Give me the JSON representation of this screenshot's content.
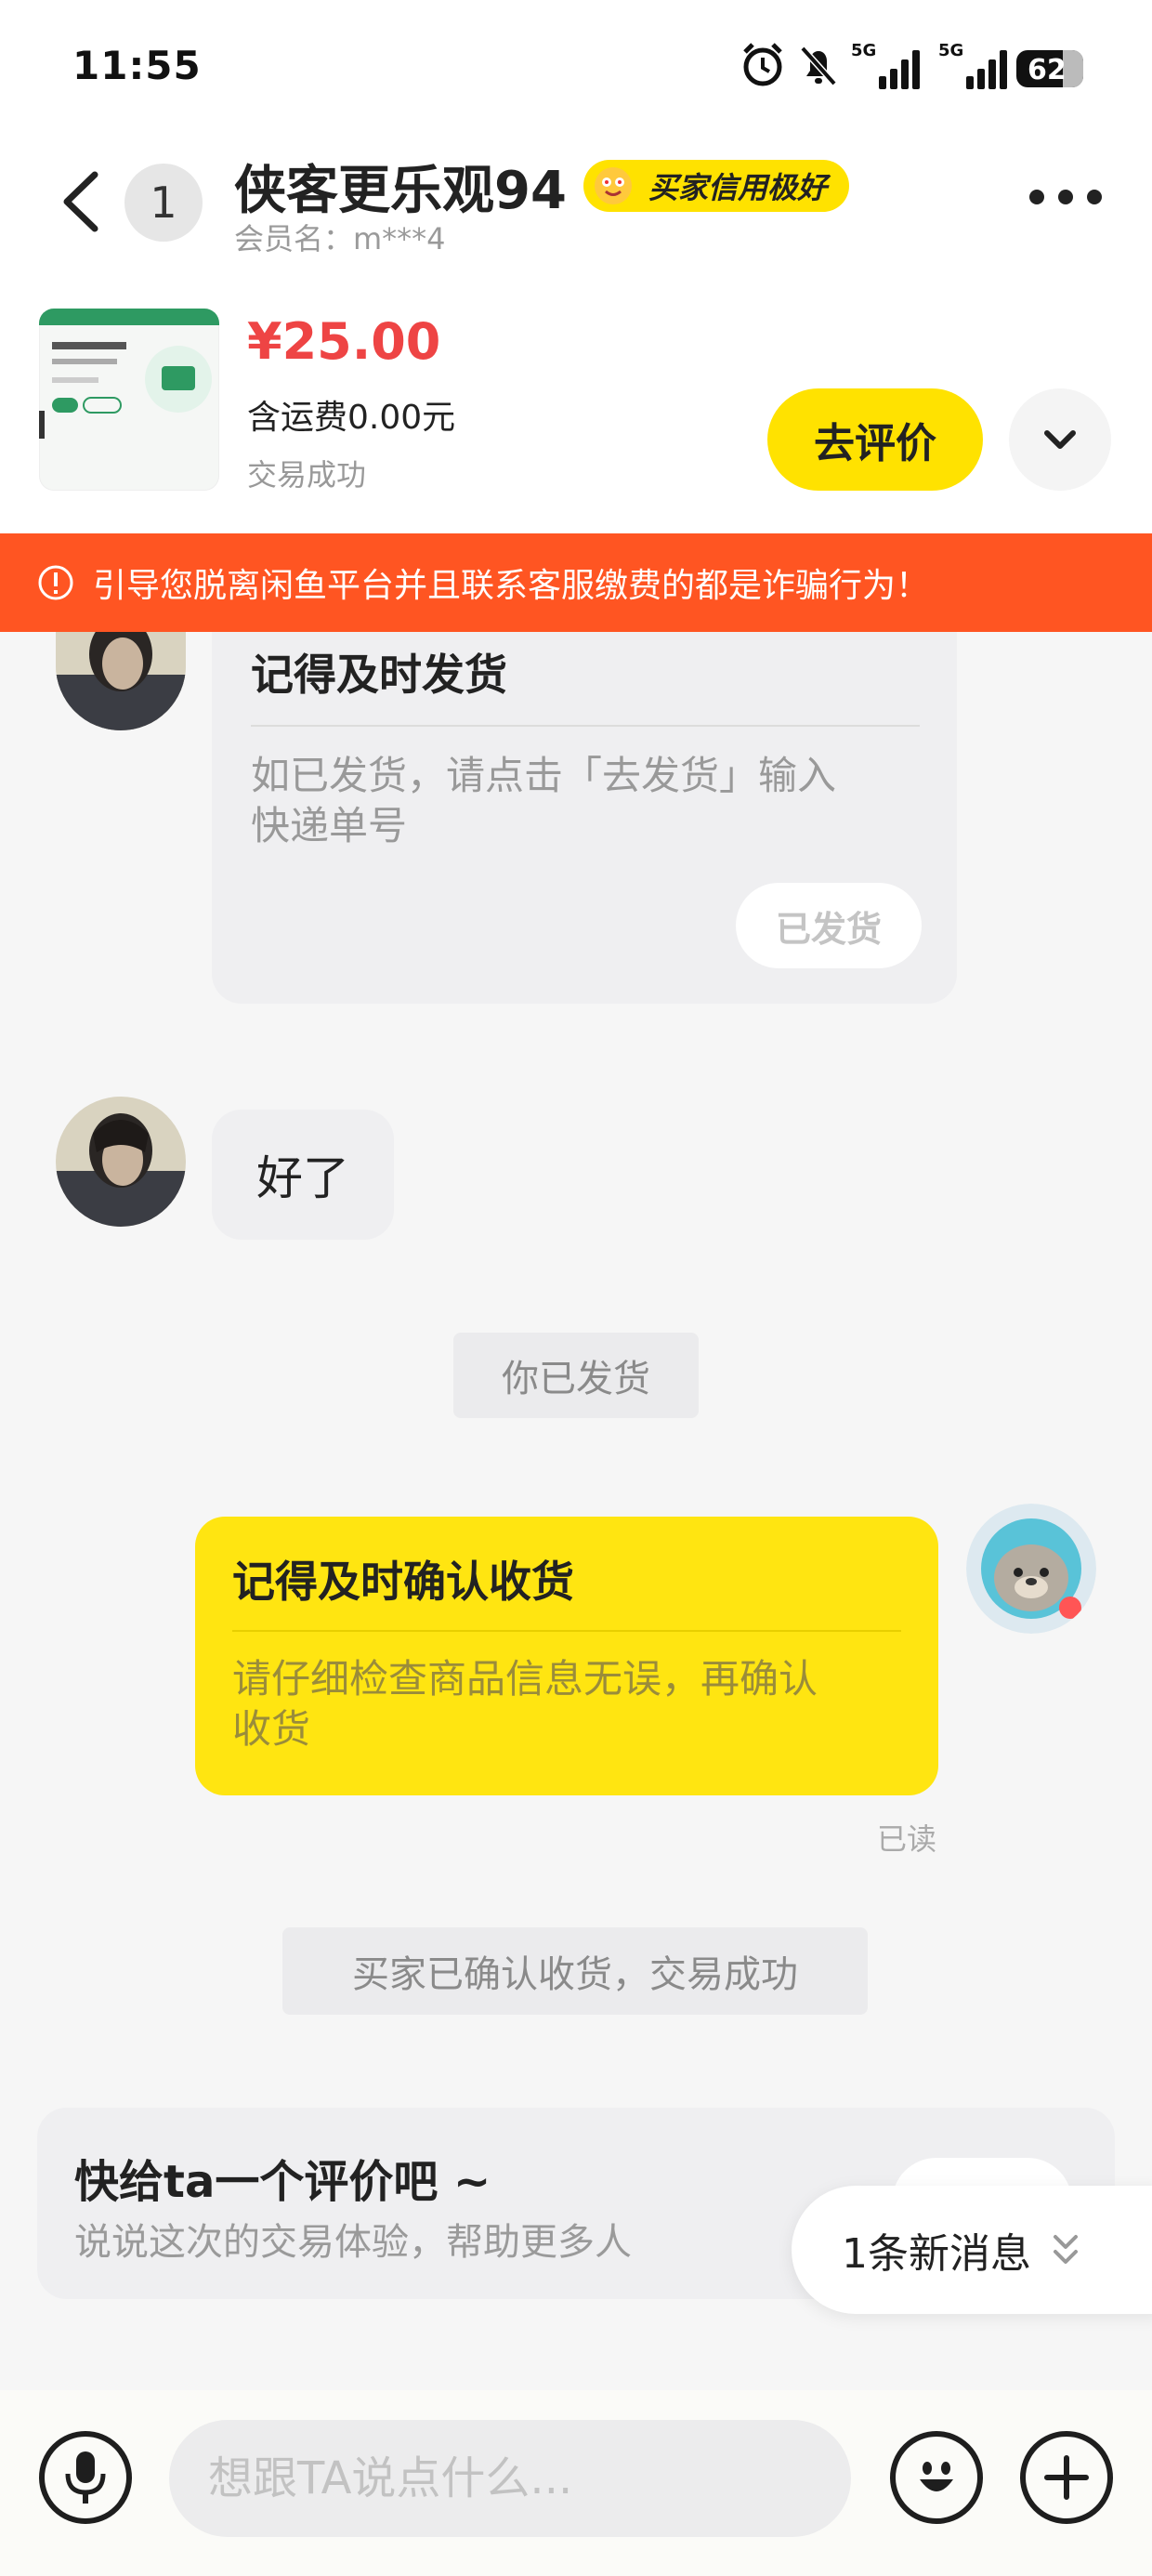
{
  "status_bar": {
    "time": "11:55",
    "network_1": "5G",
    "network_2": "5G",
    "battery": "62"
  },
  "header": {
    "unread_count": "1",
    "contact_name": "侠客更乐观94",
    "credit_badge": "买家信用极好",
    "member_label": "会员名：m***4"
  },
  "product": {
    "price": "¥25.00",
    "shipping": "含运费0.00元",
    "status": "交易成功",
    "review_button": "去评价"
  },
  "warning_banner": "引导您脱离闲鱼平台并且联系客服缴费的都是诈骗行为！",
  "messages": {
    "ship_card": {
      "title": "记得及时发货",
      "body_line1": "如已发货，请点击「去发货」输入",
      "body_line2": "快递单号",
      "button": "已发货"
    },
    "text_reply": "好了",
    "system_shipped": "你已发货",
    "confirm_card": {
      "title": "记得及时确认收货",
      "body_line1": "请仔细检查商品信息无误，再确认",
      "body_line2": "收货"
    },
    "read_receipt": "已读",
    "system_confirmed": "买家已确认收货，交易成功",
    "review_prompt": {
      "title": "快给ta一个评价吧 ~",
      "subtitle": "说说这次的交易体验，帮助更多人"
    }
  },
  "new_message_pill": "1条新消息",
  "input": {
    "placeholder": "想跟TA说点什么..."
  },
  "colors": {
    "accent_yellow": "#ffe200",
    "warning_orange": "#ff5522",
    "price_red": "#ee4444"
  }
}
